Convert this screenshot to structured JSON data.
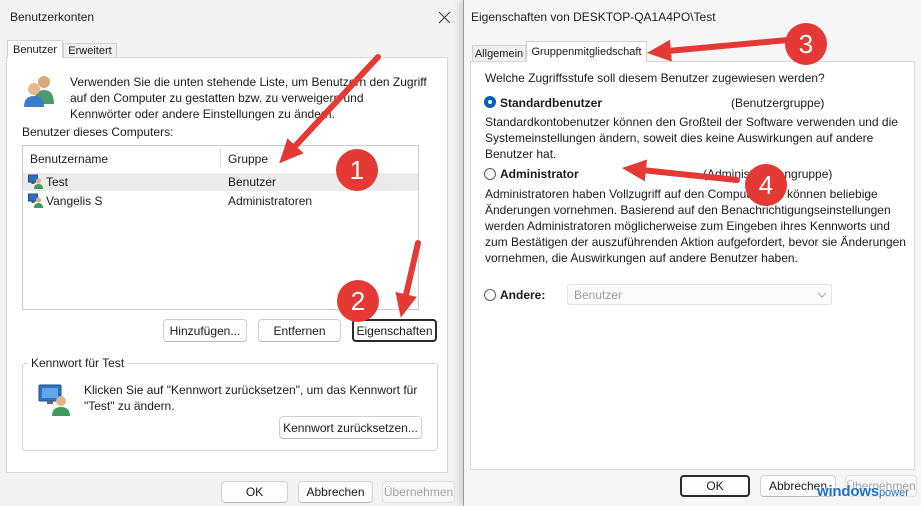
{
  "colors": {
    "annotation": "#e53935",
    "accent": "#005fb8",
    "watermark": "#1f6fc5"
  },
  "left_dialog": {
    "title": "Benutzerkonten",
    "tabs": [
      {
        "label": "Benutzer",
        "active": true
      },
      {
        "label": "Erweitert",
        "active": false
      }
    ],
    "intro_lines": [
      "Verwenden Sie die unten stehende Liste, um Benutzern den Zugriff",
      "auf den Computer zu gestatten bzw. zu verweigern und",
      "Kennwörter oder andere Einstellungen zu ändern."
    ],
    "users_label": "Benutzer dieses Computers:",
    "columns": {
      "name": "Benutzername",
      "group": "Gruppe"
    },
    "rows": [
      {
        "name": "Test",
        "group": "Benutzer",
        "selected": true
      },
      {
        "name": "Vangelis S",
        "group": "Administratoren",
        "selected": false
      }
    ],
    "buttons": {
      "add": "Hinzufügen...",
      "remove": "Entfernen",
      "properties": "Eigenschaften"
    },
    "password_group": {
      "title": "Kennwort für Test",
      "lines": [
        "Klicken Sie auf \"Kennwort zurücksetzen\", um das Kennwort für",
        "\"Test\" zu ändern."
      ],
      "reset_button": "Kennwort zurücksetzen..."
    },
    "footer": {
      "ok": "OK",
      "cancel": "Abbrechen",
      "apply": {
        "label": "Übernehmen",
        "enabled": false
      }
    }
  },
  "right_dialog": {
    "title": "Eigenschaften von DESKTOP-QA1A4PO\\Test",
    "tabs": [
      {
        "label": "Allgemein",
        "active": false
      },
      {
        "label": "Gruppenmitgliedschaft",
        "active": true
      }
    ],
    "question": "Welche Zugriffsstufe soll diesem Benutzer zugewiesen werden?",
    "options": [
      {
        "label": "Standardbenutzer",
        "group": "(Benutzergruppe)",
        "selected": true,
        "description": [
          "Standardkontobenutzer können den Großteil der Software verwenden und die",
          "Systemeinstellungen ändern, soweit dies keine Auswirkungen auf andere",
          "Benutzer hat."
        ]
      },
      {
        "label": "Administrator",
        "group": "(Administratorengruppe)",
        "selected": false,
        "description": [
          "Administratoren haben Vollzugriff auf den Computer und können beliebige",
          "Änderungen vornehmen. Basierend auf den Benachrichtigungseinstellungen",
          "werden Administratoren möglicherweise zum Eingeben ihres Kennworts und",
          "zum Bestätigen der auszuführenden Aktion aufgefordert, bevor sie Änderungen",
          "vornehmen, die Auswirkungen auf andere Benutzer haben."
        ]
      },
      {
        "label": "Andere:",
        "selected": false
      }
    ],
    "other_select": {
      "value": "Benutzer",
      "enabled": false
    },
    "footer": {
      "ok": "OK",
      "cancel": "Abbrechen",
      "apply": {
        "label": "Übernehmen",
        "enabled": false
      }
    }
  },
  "annotations": [
    "1",
    "2",
    "3",
    "4"
  ],
  "watermark": {
    "brand": "windows",
    "suffix": "power"
  }
}
